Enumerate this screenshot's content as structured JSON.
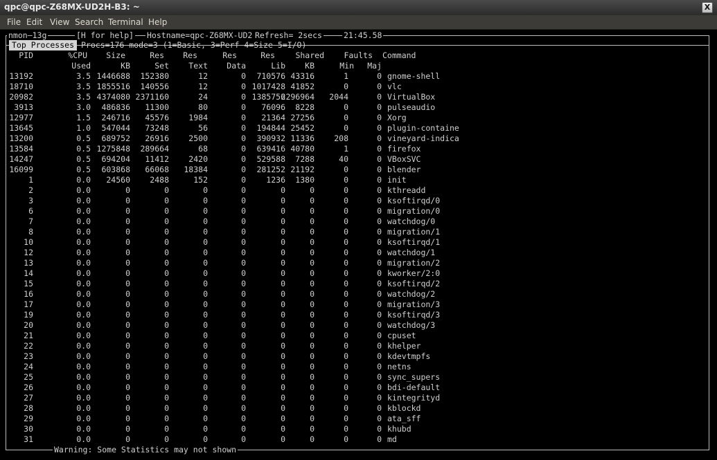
{
  "window": {
    "title": "qpc@qpc-Z68MX-UD2H-B3: ~",
    "close_glyph": "X"
  },
  "menu": [
    "File",
    "Edit",
    "View",
    "Search",
    "Terminal",
    "Help"
  ],
  "nmon": {
    "version": "nmon—13g",
    "help": "[H for help]",
    "hostname": "Hostname=qpc-Z68MX-UD2",
    "refresh": "Refresh= 2secs",
    "clock": "21:45.58",
    "section": "Top Processes",
    "procs_info": "Procs=176 mode=3 (1=Basic, 3=Perf 4=Size 5=I/O)",
    "warning": "Warning: Some Statistics may not shown"
  },
  "headers1": [
    "PID",
    "%CPU",
    "Size",
    "Res",
    "Res",
    "Res",
    "Res",
    "Shared",
    "Faults",
    "Command"
  ],
  "headers2": [
    "",
    "Used",
    "KB",
    "Set",
    "Text",
    "Data",
    "Lib",
    "KB",
    "Min",
    "Maj"
  ],
  "rows": [
    [
      "13192",
      "3.5",
      "1446688",
      "152380",
      "12",
      "0",
      "710576",
      "43316",
      "1",
      "0",
      "gnome-shell"
    ],
    [
      "18710",
      "3.5",
      "1855516",
      "140556",
      "12",
      "0",
      "1017428",
      "41852",
      "0",
      "0",
      "vlc"
    ],
    [
      "20982",
      "3.5",
      "4374080",
      "2371160",
      "24",
      "0",
      "1385756",
      "2296964",
      "2044",
      "0",
      "VirtualBox"
    ],
    [
      "3913",
      "3.0",
      "486836",
      "11300",
      "80",
      "0",
      "76096",
      "8228",
      "0",
      "0",
      "pulseaudio"
    ],
    [
      "12977",
      "1.5",
      "246716",
      "45576",
      "1984",
      "0",
      "21364",
      "27256",
      "0",
      "0",
      "Xorg"
    ],
    [
      "13645",
      "1.0",
      "547044",
      "73248",
      "56",
      "0",
      "194844",
      "25452",
      "0",
      "0",
      "plugin-containe"
    ],
    [
      "13200",
      "0.5",
      "689752",
      "26916",
      "2500",
      "0",
      "390932",
      "11336",
      "208",
      "0",
      "vineyard-indica"
    ],
    [
      "13584",
      "0.5",
      "1275848",
      "289664",
      "68",
      "0",
      "639416",
      "40780",
      "1",
      "0",
      "firefox"
    ],
    [
      "14247",
      "0.5",
      "694204",
      "11412",
      "2420",
      "0",
      "529588",
      "7288",
      "40",
      "0",
      "VBoxSVC"
    ],
    [
      "16099",
      "0.5",
      "603868",
      "66068",
      "18384",
      "0",
      "281252",
      "21192",
      "0",
      "0",
      "blender"
    ],
    [
      "1",
      "0.0",
      "24560",
      "2488",
      "152",
      "0",
      "1236",
      "1380",
      "0",
      "0",
      "init"
    ],
    [
      "2",
      "0.0",
      "0",
      "0",
      "0",
      "0",
      "0",
      "0",
      "0",
      "0",
      "kthreadd"
    ],
    [
      "3",
      "0.0",
      "0",
      "0",
      "0",
      "0",
      "0",
      "0",
      "0",
      "0",
      "ksoftirqd/0"
    ],
    [
      "6",
      "0.0",
      "0",
      "0",
      "0",
      "0",
      "0",
      "0",
      "0",
      "0",
      "migration/0"
    ],
    [
      "7",
      "0.0",
      "0",
      "0",
      "0",
      "0",
      "0",
      "0",
      "0",
      "0",
      "watchdog/0"
    ],
    [
      "8",
      "0.0",
      "0",
      "0",
      "0",
      "0",
      "0",
      "0",
      "0",
      "0",
      "migration/1"
    ],
    [
      "10",
      "0.0",
      "0",
      "0",
      "0",
      "0",
      "0",
      "0",
      "0",
      "0",
      "ksoftirqd/1"
    ],
    [
      "12",
      "0.0",
      "0",
      "0",
      "0",
      "0",
      "0",
      "0",
      "0",
      "0",
      "watchdog/1"
    ],
    [
      "13",
      "0.0",
      "0",
      "0",
      "0",
      "0",
      "0",
      "0",
      "0",
      "0",
      "migration/2"
    ],
    [
      "14",
      "0.0",
      "0",
      "0",
      "0",
      "0",
      "0",
      "0",
      "0",
      "0",
      "kworker/2:0"
    ],
    [
      "15",
      "0.0",
      "0",
      "0",
      "0",
      "0",
      "0",
      "0",
      "0",
      "0",
      "ksoftirqd/2"
    ],
    [
      "16",
      "0.0",
      "0",
      "0",
      "0",
      "0",
      "0",
      "0",
      "0",
      "0",
      "watchdog/2"
    ],
    [
      "17",
      "0.0",
      "0",
      "0",
      "0",
      "0",
      "0",
      "0",
      "0",
      "0",
      "migration/3"
    ],
    [
      "19",
      "0.0",
      "0",
      "0",
      "0",
      "0",
      "0",
      "0",
      "0",
      "0",
      "ksoftirqd/3"
    ],
    [
      "20",
      "0.0",
      "0",
      "0",
      "0",
      "0",
      "0",
      "0",
      "0",
      "0",
      "watchdog/3"
    ],
    [
      "21",
      "0.0",
      "0",
      "0",
      "0",
      "0",
      "0",
      "0",
      "0",
      "0",
      "cpuset"
    ],
    [
      "22",
      "0.0",
      "0",
      "0",
      "0",
      "0",
      "0",
      "0",
      "0",
      "0",
      "khelper"
    ],
    [
      "23",
      "0.0",
      "0",
      "0",
      "0",
      "0",
      "0",
      "0",
      "0",
      "0",
      "kdevtmpfs"
    ],
    [
      "24",
      "0.0",
      "0",
      "0",
      "0",
      "0",
      "0",
      "0",
      "0",
      "0",
      "netns"
    ],
    [
      "25",
      "0.0",
      "0",
      "0",
      "0",
      "0",
      "0",
      "0",
      "0",
      "0",
      "sync_supers"
    ],
    [
      "26",
      "0.0",
      "0",
      "0",
      "0",
      "0",
      "0",
      "0",
      "0",
      "0",
      "bdi-default"
    ],
    [
      "27",
      "0.0",
      "0",
      "0",
      "0",
      "0",
      "0",
      "0",
      "0",
      "0",
      "kintegrityd"
    ],
    [
      "28",
      "0.0",
      "0",
      "0",
      "0",
      "0",
      "0",
      "0",
      "0",
      "0",
      "kblockd"
    ],
    [
      "29",
      "0.0",
      "0",
      "0",
      "0",
      "0",
      "0",
      "0",
      "0",
      "0",
      "ata_sff"
    ],
    [
      "30",
      "0.0",
      "0",
      "0",
      "0",
      "0",
      "0",
      "0",
      "0",
      "0",
      "khubd"
    ],
    [
      "31",
      "0.0",
      "0",
      "0",
      "0",
      "0",
      "0",
      "0",
      "0",
      "0",
      "md"
    ]
  ]
}
